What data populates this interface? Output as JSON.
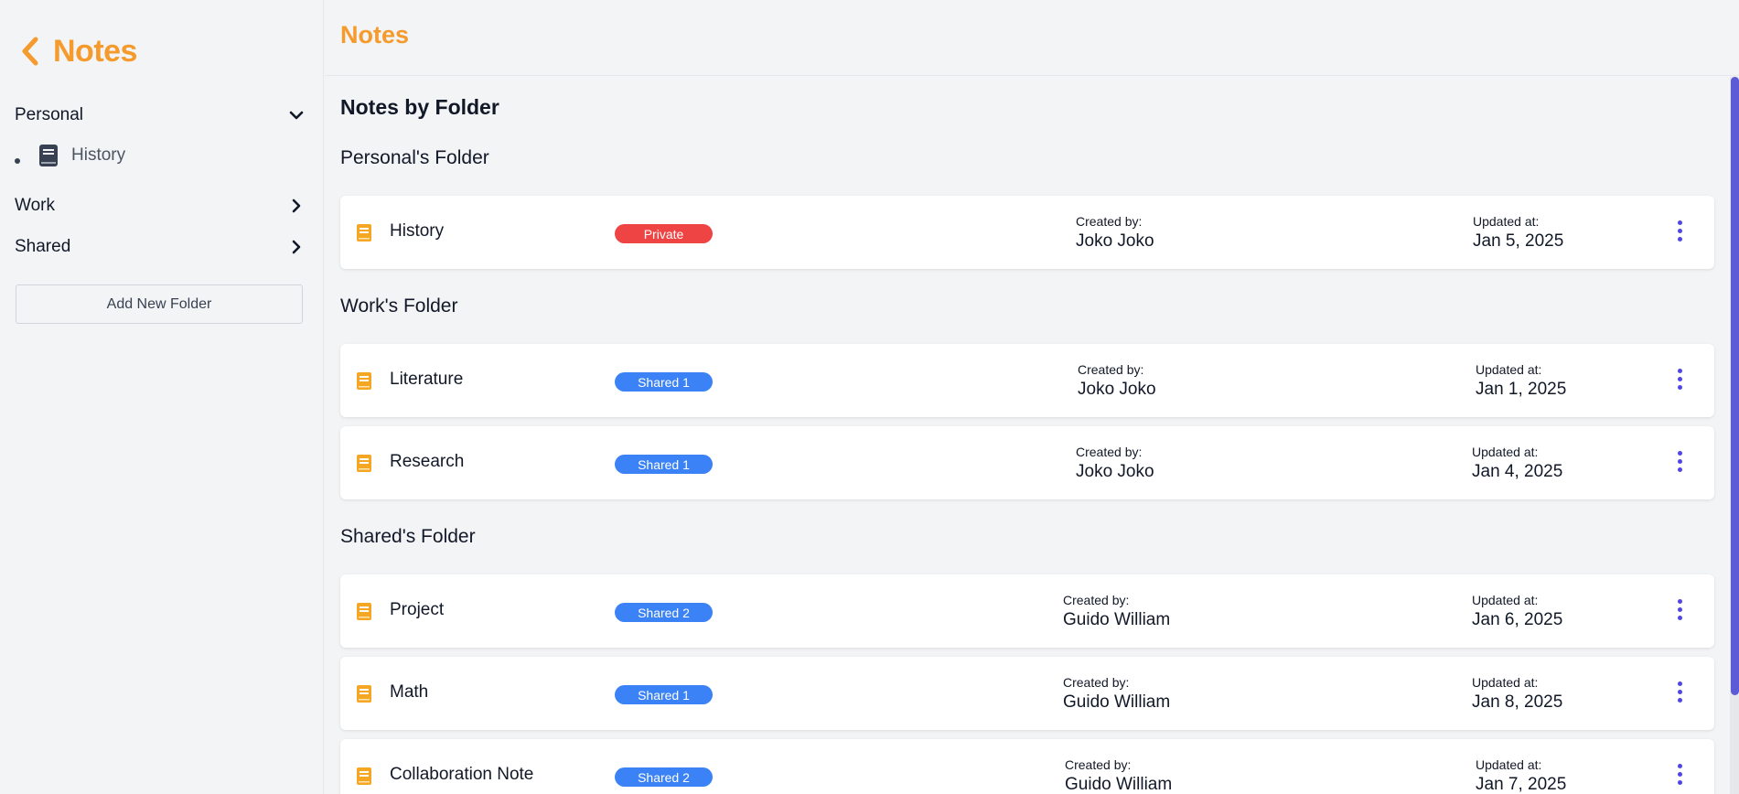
{
  "sidebar": {
    "brand": "Notes",
    "folders": [
      {
        "name": "Personal",
        "expanded": true
      },
      {
        "name": "Work",
        "expanded": false
      },
      {
        "name": "Shared",
        "expanded": false
      }
    ],
    "personal_items": [
      {
        "name": "History"
      }
    ],
    "add_folder_label": "Add New Folder"
  },
  "header": {
    "title": "Notes"
  },
  "main": {
    "section_title": "Notes by Folder",
    "groups": [
      {
        "heading": "Personal's Folder",
        "notes": [
          {
            "title": "History",
            "badge": "Private",
            "created_label": "Created by:",
            "created_by": "Joko Joko",
            "updated_label": "Updated at:",
            "updated_at": "Jan 5, 2025"
          }
        ]
      },
      {
        "heading": "Work's Folder",
        "notes": [
          {
            "title": "Literature",
            "badge": "Shared 1",
            "created_label": "Created by:",
            "created_by": "Joko Joko",
            "updated_label": "Updated at:",
            "updated_at": "Jan 1, 2025"
          },
          {
            "title": "Research",
            "badge": "Shared 1",
            "created_label": "Created by:",
            "created_by": "Joko Joko",
            "updated_label": "Updated at:",
            "updated_at": "Jan 4, 2025"
          }
        ]
      },
      {
        "heading": "Shared's Folder",
        "notes": [
          {
            "title": "Project",
            "badge": "Shared 2",
            "created_label": "Created by:",
            "created_by": "Guido William",
            "updated_label": "Updated at:",
            "updated_at": "Jan 6, 2025"
          },
          {
            "title": "Math",
            "badge": "Shared 1",
            "created_label": "Created by:",
            "created_by": "Guido William",
            "updated_label": "Updated at:",
            "updated_at": "Jan 8, 2025"
          },
          {
            "title": "Collaboration Note",
            "badge": "Shared 2",
            "created_label": "Created by:",
            "created_by": "Guido William",
            "updated_label": "Updated at:",
            "updated_at": "Jan 7, 2025"
          }
        ]
      }
    ]
  },
  "colors": {
    "accent": "#f59a2c",
    "private": "#ef4444",
    "shared": "#3b82f6",
    "kebab": "#4f46e5"
  },
  "icons": {
    "back": "chevron-left-icon",
    "expanded": "chevron-down-icon",
    "collapsed": "chevron-right-icon",
    "note": "book-icon",
    "menu": "kebab-menu-icon"
  }
}
